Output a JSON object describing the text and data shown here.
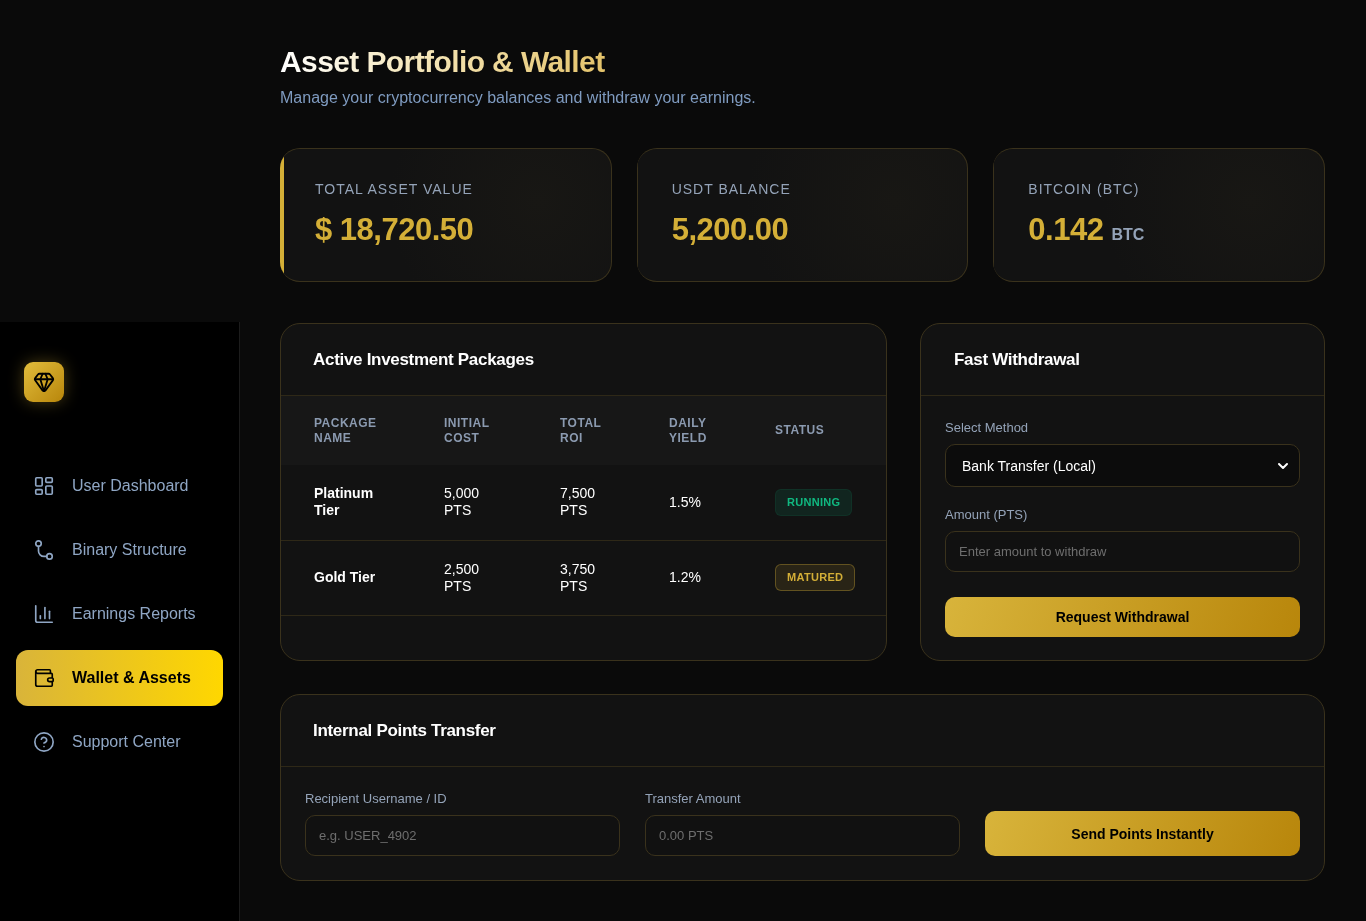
{
  "sidebar": {
    "nav": [
      {
        "label": "User Dashboard",
        "selected": false
      },
      {
        "label": "Binary Structure",
        "selected": false
      },
      {
        "label": "Earnings Reports",
        "selected": false
      },
      {
        "label": "Wallet & Assets",
        "selected": true
      },
      {
        "label": "Support Center",
        "selected": false
      }
    ]
  },
  "header": {
    "title": "Asset Portfolio & Wallet",
    "subtitle": "Manage your cryptocurrency balances and withdraw your earnings."
  },
  "stats": [
    {
      "label": "TOTAL ASSET VALUE",
      "value": "$ 18,720.50",
      "highlighted": true
    },
    {
      "label": "USDT BALANCE",
      "value": "5,200.00",
      "highlighted": false
    },
    {
      "label": "BITCOIN (BTC)",
      "value": "0.142",
      "unit": "BTC",
      "highlighted": false
    }
  ],
  "packages": {
    "title": "Active Investment Packages",
    "columns": [
      "PACKAGE NAME",
      "INITIAL COST",
      "TOTAL ROI",
      "DAILY YIELD",
      "STATUS"
    ],
    "rows": [
      {
        "name": "Platinum Tier",
        "initial_cost": "5,000 PTS",
        "total_roi": "7,500 PTS",
        "daily_yield": "1.5%",
        "status": {
          "label": "RUNNING",
          "color": "#10b981"
        }
      },
      {
        "name": "Gold Tier",
        "initial_cost": "2,500 PTS",
        "total_roi": "3,750 PTS",
        "daily_yield": "1.2%",
        "status": {
          "label": "MATURED",
          "color": "#d4af37"
        }
      }
    ]
  },
  "withdrawal": {
    "title": "Fast Withdrawal",
    "method": {
      "label": "Select Method",
      "value": "Bank Transfer (Local)"
    },
    "amount": {
      "label": "Amount (PTS)",
      "placeholder": "Enter amount to withdraw"
    },
    "button": "Request Withdrawal"
  },
  "transfer": {
    "title": "Internal Points Transfer",
    "recipient": {
      "label": "Recipient Username / ID",
      "placeholder": "e.g. USER_4902"
    },
    "amount": {
      "label": "Transfer Amount",
      "placeholder": "0.00 PTS"
    },
    "button": "Send Points Instantly"
  }
}
